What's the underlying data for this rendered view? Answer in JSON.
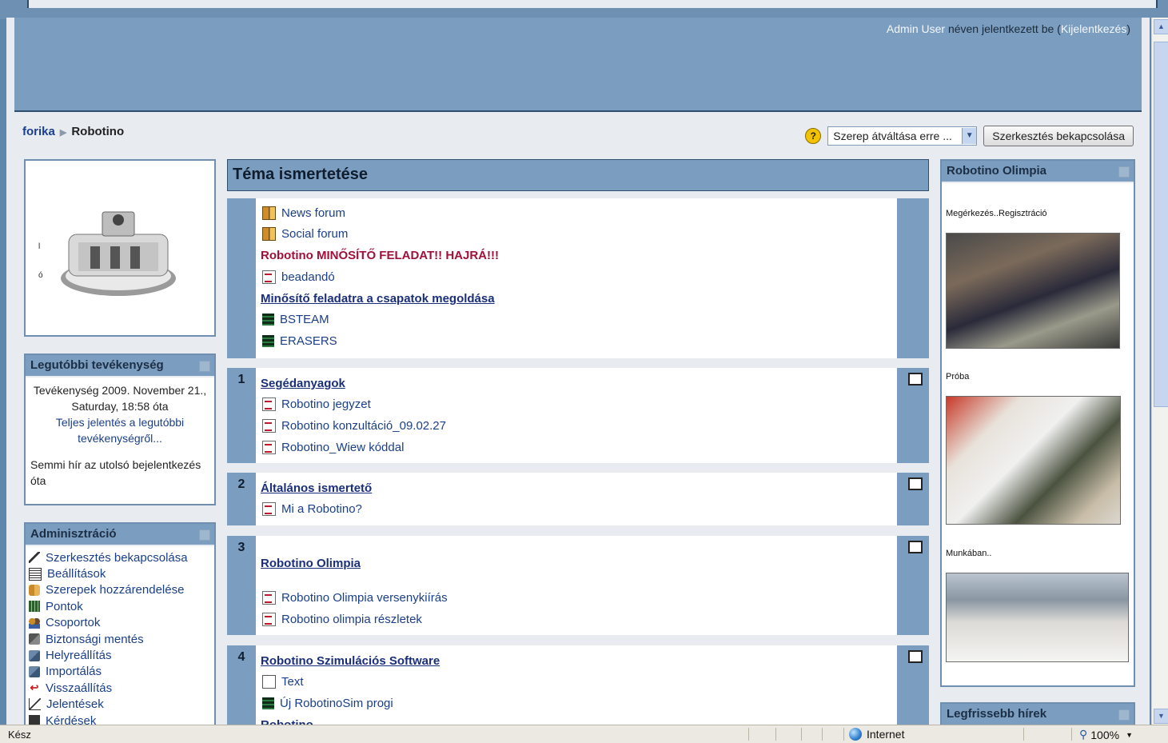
{
  "header": {
    "user_name": "Admin User",
    "logged_in_text": " néven jelentkezett be (",
    "logout_label": "Kijelentkezés",
    "close_paren": ")"
  },
  "breadcrumb": {
    "home": "forika",
    "current": "Robotino"
  },
  "controls": {
    "role_switch_value": "Szerep átváltása erre ...",
    "edit_button": "Szerkesztés bekapcsolása"
  },
  "activity": {
    "title": "Legutóbbi tevékenység",
    "since_text": "Tevékenység 2009. November 21., Saturday, 18:58 óta",
    "full_report_link": "Teljes jelentés a legutóbbi tevékenységről...",
    "no_news": "Semmi hír az utolsó bejelentkezés óta"
  },
  "admin": {
    "title": "Adminisztráció",
    "items": [
      "Szerkesztés bekapcsolása",
      "Beállítások",
      "Szerepek hozzárendelése",
      "Pontok",
      "Csoportok",
      "Biztonsági mentés",
      "Helyreállítás",
      "Importálás",
      "Visszaállítás",
      "Jelentések",
      "Kérdések"
    ]
  },
  "robot_image": {
    "side_label_1": "l",
    "side_label_2": "ó"
  },
  "main": {
    "topic_title": "Téma ismertetése",
    "section0": {
      "items": [
        "News forum",
        "Social forum"
      ],
      "red_label": "Robotino MINŐSÍTŐ FELADAT!! HAJRÁ!!!",
      "pdf_item": "beadandó",
      "sub_title": "Minősítő feladatra a csapatok megoldása",
      "db_items": [
        "BSTEAM",
        "ERASERS"
      ]
    },
    "section1": {
      "num": "1",
      "title": "Segédanyagok",
      "items": [
        "Robotino jegyzet",
        "Robotino konzultáció_09.02.27",
        "Robotino_Wiew kóddal"
      ]
    },
    "section2": {
      "num": "2",
      "title": "Általános ismertető",
      "items": [
        "Mi a Robotino?"
      ]
    },
    "section3": {
      "num": "3",
      "title": "Robotino Olimpia",
      "items": [
        "Robotino Olimpia versenykiírás",
        "Robotino olimpia részletek"
      ]
    },
    "section4": {
      "num": "4",
      "title": "Robotino Szimulációs Software",
      "items": [
        "Text",
        "Új RobotinoSim progi"
      ],
      "partial": "Robotino..."
    }
  },
  "olimpia": {
    "title": "Robotino Olimpia",
    "captions": [
      "Megérkezés..Regisztráció",
      "Próba",
      "Munkában.."
    ]
  },
  "hirek": {
    "title": "Legfrissebb hírek"
  },
  "status": {
    "ready": "Kész",
    "zone": "Internet",
    "zoom": "100%"
  }
}
